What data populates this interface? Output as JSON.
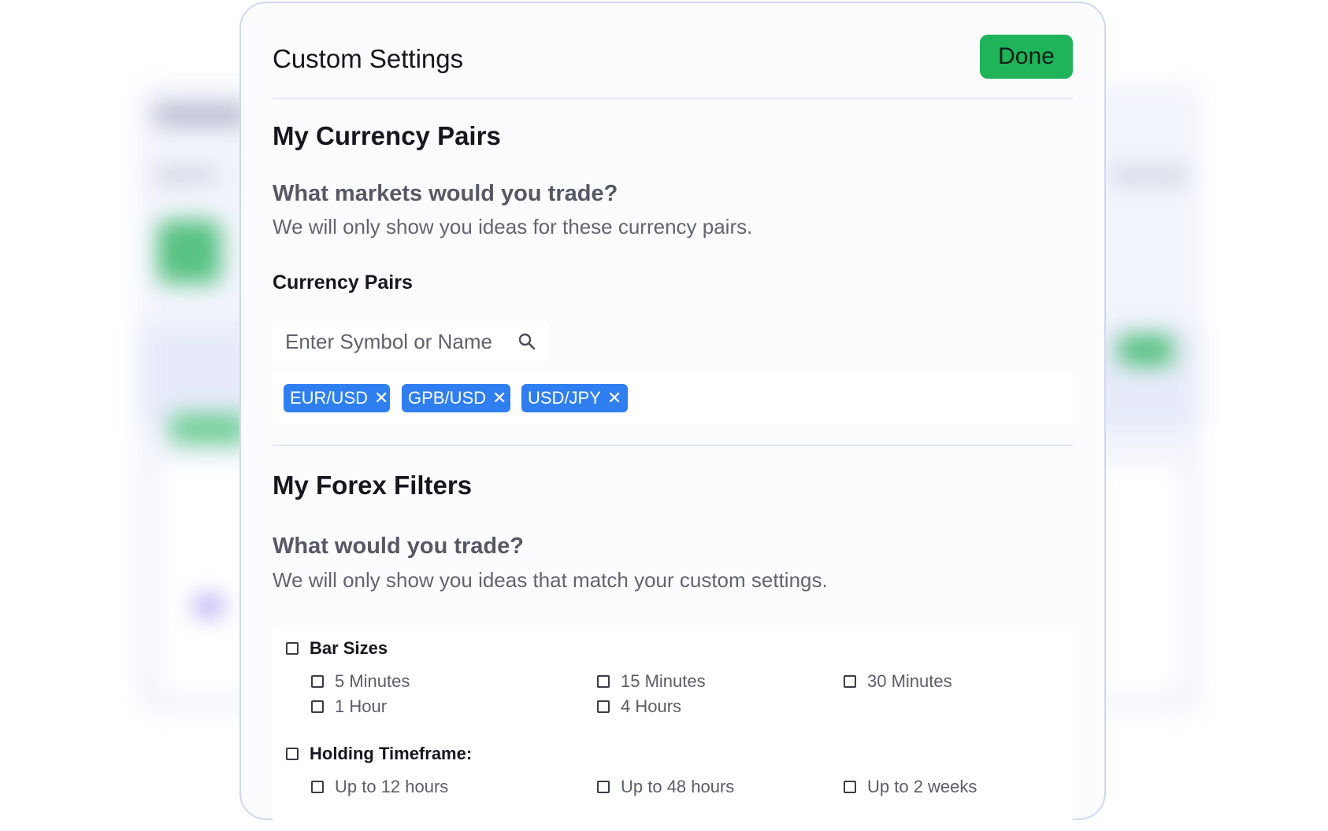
{
  "modal": {
    "title": "Custom Settings",
    "done_label": "Done"
  },
  "currency_section": {
    "title": "My Currency Pairs",
    "question": "What markets would you trade?",
    "description": "We will only show you ideas for these currency pairs.",
    "pairs_label": "Currency Pairs",
    "search_placeholder": "Enter Symbol or Name",
    "chips": [
      "EUR/USD",
      "GPB/USD",
      "USD/JPY"
    ],
    "chip_remove_glyph": "✕"
  },
  "filters_section": {
    "title": "My Forex Filters",
    "question": "What would you trade?",
    "description": "We will only show you ideas that match your custom settings.",
    "bar_sizes": {
      "label": "Bar Sizes",
      "options": [
        "5 Minutes",
        "15 Minutes",
        "30 Minutes",
        "1 Hour",
        "4 Hours"
      ]
    },
    "holding": {
      "label": "Holding Timeframe:",
      "options": [
        "Up to 12 hours",
        "Up to 48 hours",
        "Up to 2 weeks"
      ]
    }
  },
  "colors": {
    "done_button": "#1fb35a",
    "chip": "#2f7ff0",
    "modal_border": "#cdd9f3"
  }
}
